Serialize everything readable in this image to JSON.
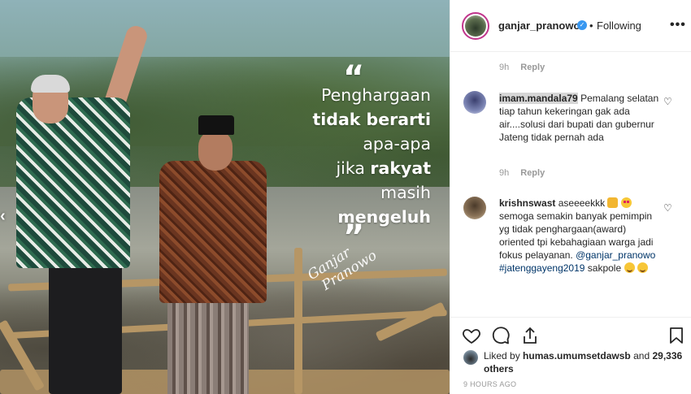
{
  "post": {
    "quote": {
      "line1": "Penghargaan",
      "line2": "tidak berarti",
      "line3": "apa-apa",
      "line4_pre": "jika ",
      "line4_bold": "rakyat",
      "line5": "masih",
      "line6": "mengeluh",
      "open_mark": "“",
      "close_mark": "”"
    },
    "signature": {
      "first": "Ganjar",
      "last": "Pranowo"
    },
    "prev_arrow": "‹"
  },
  "header": {
    "username": "ganjar_pranowo",
    "verified_icon": "verified-badge-icon",
    "separator": "•",
    "follow_status": "Following",
    "more_label": "•••"
  },
  "comments": {
    "top_meta": {
      "time": "9h",
      "reply": "Reply"
    },
    "c1": {
      "username": "imam.mandala79",
      "text": "Pemalang selatan tiap tahun kekeringan gak ada air....solusi dari bupati dan gubernur Jateng tidak pernah ada",
      "time": "9h",
      "reply": "Reply"
    },
    "c2": {
      "username": "krishnswast",
      "text_1": "aseeeekkk",
      "text_2": "semoga semakin banyak pemimpin yg tidak penghargaan(award) oriented tpi kebahagiaan warga jadi fokus pelayanan.",
      "mention": "@ganjar_pranowo",
      "hashtag": "#jatenggayeng2019",
      "text_3": "sakpole"
    }
  },
  "likes": {
    "prefix": "Liked by",
    "user": "humas.umumsetdawsb",
    "joiner": "and",
    "count": "29,336 others"
  },
  "timestamp": "9 HOURS AGO",
  "colors": {
    "link": "#003569",
    "muted": "#999999",
    "verified": "#3897f0",
    "story_ring": "#c1358c"
  }
}
